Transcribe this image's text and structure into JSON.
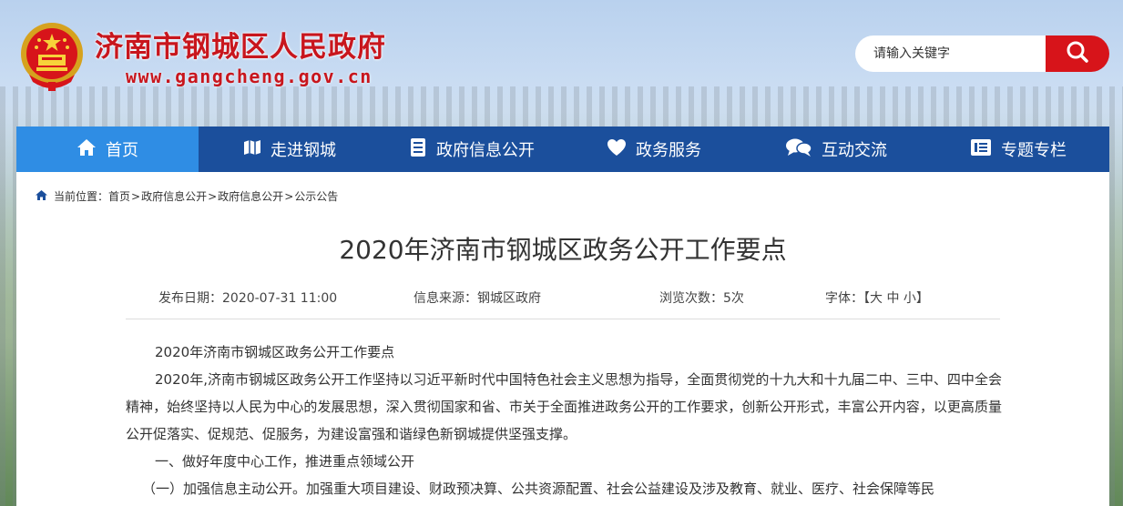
{
  "header": {
    "site_title": "济南市钢城区人民政府",
    "site_url": "www.gangcheng.gov.cn",
    "emblem_icon": "national-emblem-icon"
  },
  "search": {
    "placeholder": "请输入关键字",
    "button_icon": "search-icon"
  },
  "nav": {
    "items": [
      {
        "label": "首页",
        "icon": "home-icon",
        "active": true
      },
      {
        "label": "走进钢城",
        "icon": "map-icon"
      },
      {
        "label": "政府信息公开",
        "icon": "document-icon"
      },
      {
        "label": "政务服务",
        "icon": "heart-icon"
      },
      {
        "label": "互动交流",
        "icon": "chat-icon"
      },
      {
        "label": "专题专栏",
        "icon": "list-icon"
      }
    ]
  },
  "breadcrumb": {
    "prefix": "当前位置：",
    "items": [
      "首页",
      "政府信息公开",
      "政府信息公开",
      "公示公告"
    ],
    "separator": ">"
  },
  "article": {
    "title": "2020年济南市钢城区政务公开工作要点",
    "publish_date": "发布日期：2020-07-31 11:00",
    "source": "信息来源：钢城区政府",
    "views": "浏览次数：5次",
    "font_size_label": "字体：【大 中 小】",
    "paragraphs": [
      "2020年济南市钢城区政务公开工作要点",
      "2020年,济南市钢城区政务公开工作坚持以习近平新时代中国特色社会主义思想为指导，全面贯彻党的十九大和十九届二中、三中、四中全会精神，始终坚持以人民为中心的发展思想，深入贯彻国家和省、市关于全面推进政务公开的工作要求，创新公开形式，丰富公开内容，以更高质量公开促落实、促规范、促服务，为建设富强和谐绿色新钢城提供坚强支撑。",
      "一、做好年度中心工作，推进重点领域公开",
      "（一）加强信息主动公开。加强重大项目建设、财政预决算、公共资源配置、社会公益建设及涉及教育、就业、医疗、社会保障等民"
    ]
  },
  "colors": {
    "brand_red": "#c8161d",
    "nav_blue": "#1b4f9c",
    "nav_active": "#2f8de4"
  }
}
